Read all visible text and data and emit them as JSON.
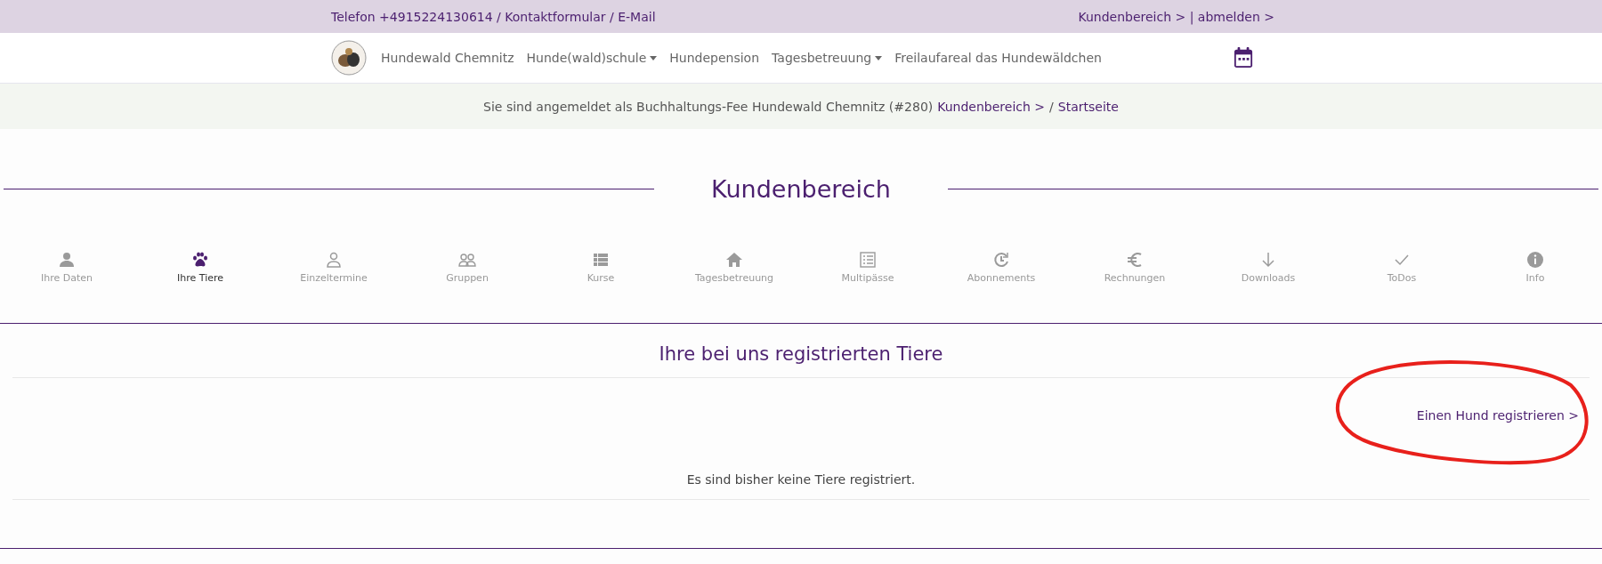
{
  "top_bar": {
    "contact": "Telefon +4915224130614 / Kontaktformular / E-Mail",
    "account": "Kundenbereich > | abmelden >"
  },
  "nav": {
    "items": [
      {
        "label": "Hundewald Chemnitz",
        "dropdown": false
      },
      {
        "label": "Hunde(wald)schule",
        "dropdown": true
      },
      {
        "label": "Hundepension",
        "dropdown": false
      },
      {
        "label": "Tagesbetreuung",
        "dropdown": true
      },
      {
        "label": "Freilaufareal das Hundewäldchen",
        "dropdown": false
      }
    ]
  },
  "login_bar": {
    "text": "Sie sind angemeldet als Buchhaltungs-Fee Hundewald Chemnitz (#280)",
    "link_1": "Kundenbereich >",
    "separator": "/",
    "link_2": "Startseite"
  },
  "page_title": "Kundenbereich",
  "tabs": [
    {
      "label": "Ihre Daten",
      "selected": false
    },
    {
      "label": "Ihre Tiere",
      "selected": true
    },
    {
      "label": "Einzeltermine",
      "selected": false
    },
    {
      "label": "Gruppen",
      "selected": false
    },
    {
      "label": "Kurse",
      "selected": false
    },
    {
      "label": "Tagesbetreuung",
      "selected": false
    },
    {
      "label": "Multipässe",
      "selected": false
    },
    {
      "label": "Abonnements",
      "selected": false
    },
    {
      "label": "Rechnungen",
      "selected": false
    },
    {
      "label": "Downloads",
      "selected": false
    },
    {
      "label": "ToDos",
      "selected": false
    },
    {
      "label": "Info",
      "selected": false
    }
  ],
  "section": {
    "title": "Ihre bei uns registrierten Tiere",
    "register_link": "Einen Hund registrieren >",
    "empty_message": "Es sind bisher keine Tiere registriert."
  }
}
